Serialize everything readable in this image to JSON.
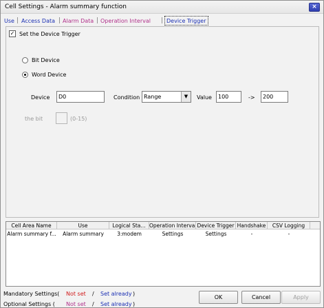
{
  "window": {
    "title": "Cell Settings - Alarm summary function",
    "close_glyph": "×"
  },
  "tabs": [
    {
      "label": "Use",
      "color": "#1a2fb3"
    },
    {
      "label": "Access Data",
      "color": "#1a2fb3"
    },
    {
      "label": "Alarm Data",
      "color": "#b0308a"
    },
    {
      "label": "Operation Interval",
      "color": "#b0308a"
    },
    {
      "label": "Device Trigger",
      "color": "#1a2fb3",
      "active": true
    }
  ],
  "trigger": {
    "set_checkbox_label": "Set the Device Trigger",
    "set_checked": true,
    "check_glyph": "✓",
    "bit_device_label": "Bit Device",
    "word_device_label": "Word Device",
    "selected_mode": "Word Device",
    "device_label": "Device",
    "device_value": "D0",
    "condition_label": "Condition",
    "condition_value": "Range",
    "value_label": "Value",
    "value_from": "100",
    "range_arrow": "->",
    "value_to": "200",
    "bit_label": "the bit",
    "bit_value": "",
    "bit_range": "(0-15)"
  },
  "grid": {
    "columns": [
      "Cell Area Name",
      "Use",
      "Logical Sta...",
      "Operation Interval",
      "Device Trigger",
      "Handshake",
      "CSV Logging"
    ],
    "rows": [
      [
        "Alarm summary f...",
        "Alarm summary",
        "3:modem",
        "Settings",
        "Settings",
        "-",
        "-"
      ]
    ]
  },
  "status": {
    "mandatory_label": "Mandatory Settings(",
    "optional_label": "Optional Settings  (",
    "not_set": "Not set",
    "slash": "/",
    "set_already": "Set already",
    "close_paren": ")"
  },
  "buttons": {
    "ok": "OK",
    "cancel": "Cancel",
    "apply": "Apply"
  },
  "colors": {
    "link_blue": "#1a2fb3",
    "magenta": "#b0308a",
    "not_set_red": "#d11a1a"
  }
}
